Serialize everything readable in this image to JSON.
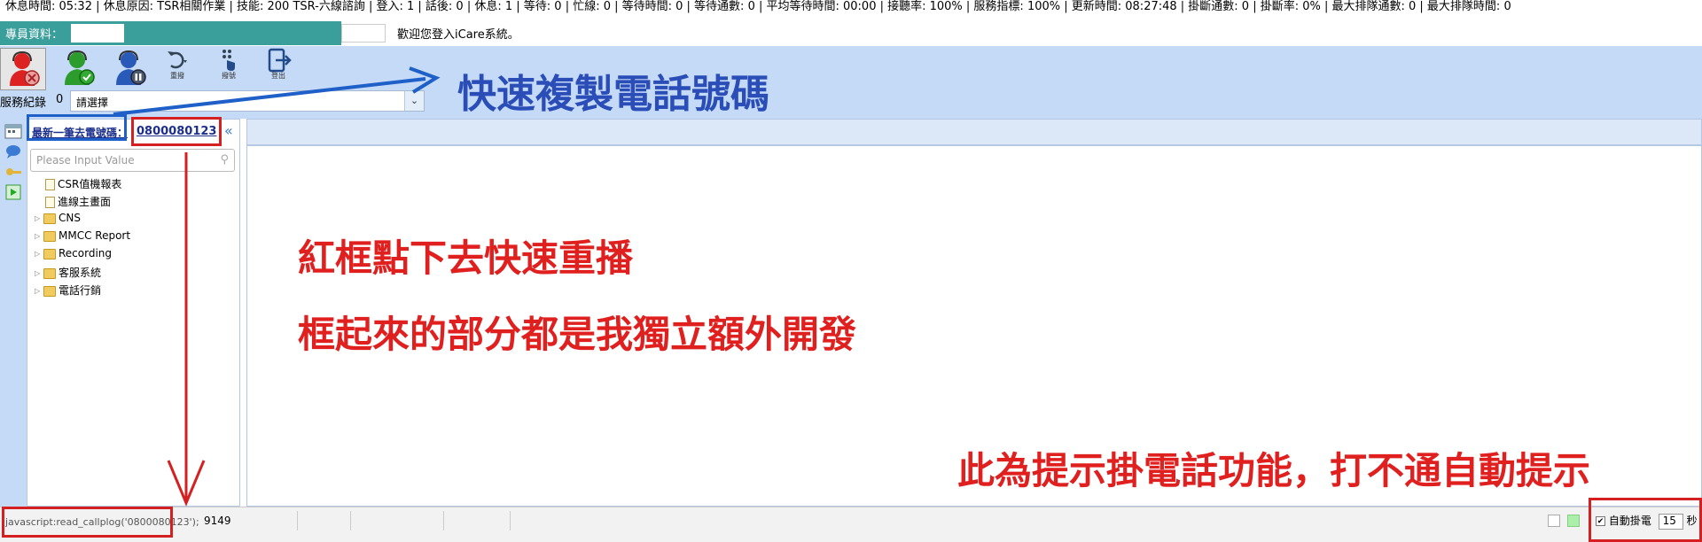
{
  "status_bar": {
    "text": "休息時間: 05:32 | 休息原因: TSR相關作業 | 技能: 200 TSR-六線諮詢 | 登入: 1 | 話後: 0 | 休息: 1 | 等待: 0 | 忙線: 0 | 等待時間: 0 | 等待通數: 0 | 平均等待時間: 00:00 | 接聽率: 100% | 服務指標: 100% | 更新時間: 08:27:48 | 掛斷通數: 0 | 掛斷率: 0% | 最大排隊通數: 0 | 最大排隊時間: 0"
  },
  "agent_row": {
    "label": "專員資料：",
    "welcome": "歡迎您登入iCare系統。"
  },
  "toolbar": {
    "buttons": [
      {
        "name": "logout-phone",
        "label": ""
      },
      {
        "name": "ready",
        "label": ""
      },
      {
        "name": "pause",
        "label": ""
      },
      {
        "name": "redial",
        "label": "重撥"
      },
      {
        "name": "dial",
        "label": "撥號"
      },
      {
        "name": "signout",
        "label": "登出"
      }
    ],
    "service_record_label": "服務紀錄",
    "service_record_count": "0",
    "select_value": "請選擇"
  },
  "left_panel": {
    "last_call_label": "最新一筆去電號碼：",
    "last_call_number": "0800080123",
    "search_placeholder": "Please Input Value",
    "tree": [
      {
        "label": "CSR值機報表",
        "type": "doc"
      },
      {
        "label": "進線主畫面",
        "type": "doc"
      },
      {
        "label": "CNS",
        "type": "folder"
      },
      {
        "label": "MMCC Report",
        "type": "folder"
      },
      {
        "label": "Recording",
        "type": "folder"
      },
      {
        "label": "客服系統",
        "type": "folder"
      },
      {
        "label": "電話行銷",
        "type": "folder"
      }
    ]
  },
  "bottom_bar": {
    "js_link": "javascript:read_callplog('0800080123');",
    "status_num": "9149",
    "auto_hangup_label": "自動掛電",
    "auto_hangup_checked": "✔",
    "auto_hangup_seconds": "15",
    "seconds_unit": "秒"
  },
  "annotations": {
    "copy_phone": "快速複製電話號碼",
    "redial_hint": "紅框點下去快速重播",
    "dev_hint": "框起來的部分都是我獨立額外開發",
    "hangup_hint": "此為提示掛電話功能，打不通自動提示"
  },
  "colors": {
    "annotation_red": "#d42020",
    "annotation_blue": "#1e5fc8",
    "toolbar_bg": "#c4daf7",
    "agent_bar": "#3a9f9b"
  }
}
